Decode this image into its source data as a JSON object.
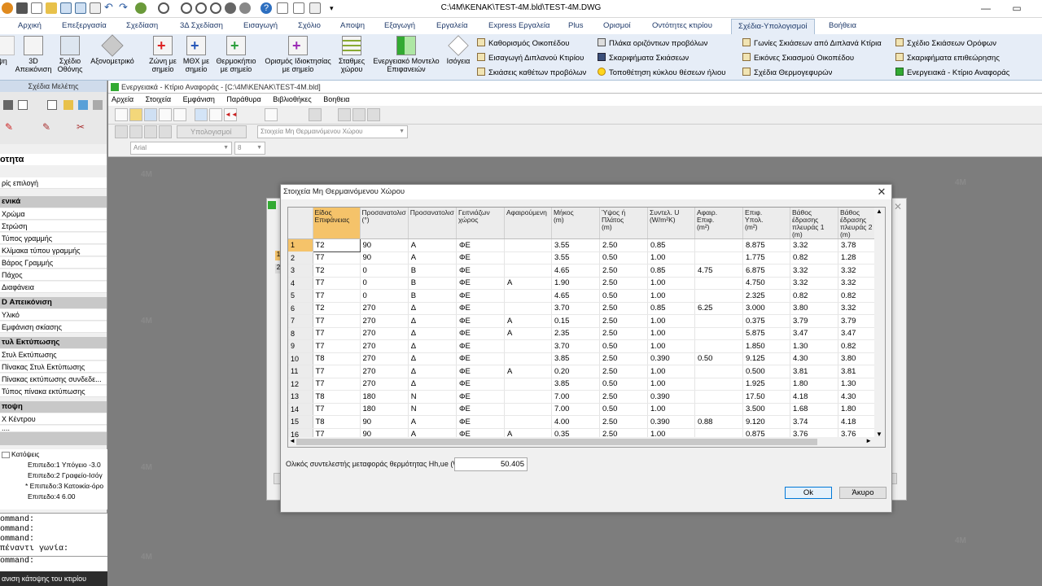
{
  "window": {
    "title": "C:\\4M\\KENAK\\TEST-4M.bld\\TEST-4M.DWG",
    "controls": [
      "—",
      "▭"
    ]
  },
  "ribbon_tabs": [
    "Αρχική",
    "Επεξεργασία",
    "Σχεδίαση",
    "3Δ Σχεδίαση",
    "Εισαγωγή",
    "Σχόλιο",
    "Αποψη",
    "Εξαγωγή",
    "Εργαλεία",
    "Express Εργαλεία",
    "Plus",
    "Ορισμοί",
    "Οντότητες κτιρίου",
    "Σχέδια-Υπολογισμοί",
    "Βοήθεια"
  ],
  "ribbon_active_tab": "Σχέδια-Υπολογισμοί",
  "ribbon_buttons": [
    {
      "label": "ψη",
      "icon": "view-icon"
    },
    {
      "label": "3D\nΑπεικόνιση",
      "icon": "3d-icon"
    },
    {
      "label": "Σχέδιο\nΟθόνης",
      "icon": "monitor-icon"
    },
    {
      "label": "Αξονομετρικό",
      "icon": "axonometric-icon"
    },
    {
      "label": "Ζώνη με\nσημείο",
      "icon": "zone-plus-icon"
    },
    {
      "label": "ΜΘΧ με\nσημείο",
      "icon": "mthx-plus-icon"
    },
    {
      "label": "Θερμοκήπιο\nμε σημείο",
      "icon": "greenhouse-plus-icon"
    },
    {
      "label": "Ορισμός Ιδιοκτησίας\nμε σημείο",
      "icon": "property-plus-icon"
    },
    {
      "label": "Σταθμες\nχώρου",
      "icon": "levels-icon"
    },
    {
      "label": "Ενεργειακό Μοντελο\nΕπιφανειών",
      "icon": "energy-model-icon"
    },
    {
      "label": "Ισόγεια",
      "icon": "ground-floor-icon"
    }
  ],
  "ribbon_small_col1": [
    "Καθορισμός Οικοπέδου",
    "Εισαγωγή Διπλανού Κτιρίου",
    "Σκιάσεις καθέτων προβόλων"
  ],
  "ribbon_small_col2": [
    "Πλάκα οριζόντιων προβόλων",
    "Σκαριφήματα Σκιάσεων",
    "Τοποθέτηση κύκλου θέσεων ήλιου"
  ],
  "ribbon_small_col3": [
    "Γωνίες Σκιάσεων από Διπλανά Κτίρια",
    "Εικόνες Σκιασμού Οικοπέδου",
    "Σχέδια Θερμογεφυρών"
  ],
  "ribbon_small_col4": [
    "Σχέδιο Σκιάσεων Ορόφων",
    "Σκαριφήματα επιθεώρησης",
    "Ενεργειακά - Κτίριο Αναφοράς"
  ],
  "ribbon_group_label": "Σχέδια Μελέτης",
  "left_panel": {
    "header": "οτητα",
    "first_item": "ρίς επιλογή",
    "sections": [
      {
        "title": "ενικά",
        "items": [
          "Χρώμα",
          "Στρώση",
          "Τύπος γραμμής",
          "Κλίμακα τύπου γραμμής",
          "Βάρος Γραμμής",
          "Πάχος",
          "Διαφάνεια"
        ]
      },
      {
        "title": "D Απεικόνιση",
        "items": [
          "Υλικό",
          "Εμφάνιση σκίασης"
        ]
      },
      {
        "title": "τυλ Εκτύπωσης",
        "items": [
          "Στυλ Εκτύπωσης",
          "Πίνακας Στυλ Εκτύπωσης",
          "Πίνακας εκτύπωσης συνδεδε...",
          "Τύπος πίνακα εκτύπωσης"
        ]
      },
      {
        "title": "ποψη",
        "items": [
          "X Κέντρου",
          "...."
        ]
      }
    ],
    "tree_root": "Κατόψεις",
    "tree_items": [
      "Επιπεδο:1 Υπόγειο -3.0",
      "Επιπεδο:2 Γραφείο-Ισόγ",
      "* Επιπεδο:3 Κατοικία-όρο",
      "Επιπεδο:4  6.00"
    ],
    "command_lines": [
      "ommand:",
      "ommand:",
      "ommand:",
      "πέναντι γωνία:",
      "ommand:"
    ],
    "status": "ανιση κάτοψης του κτιρίου"
  },
  "inner_app": {
    "title": "Ενεργειακά - Κτίριο Αναφοράς - [C:\\4M\\KENAK\\TEST-4M.bld]",
    "menu": [
      "Αρχεία",
      "Στοιχεία",
      "Εμφάνιση",
      "Παράθυρα",
      "Βιβλιοθήκες",
      "Βοηθεια"
    ],
    "compute_button": "Υπολογισμοί",
    "section_combo": "Στοιχεία Μη Θερμαινόμενου Χώρου",
    "font_combo": "Arial",
    "size_combo": "8",
    "watermark": "4M"
  },
  "bg_dialog": {
    "row_markers": [
      "1",
      "2"
    ]
  },
  "dialog": {
    "title": "Στοιχεία Μη Θερμαινόμενου Χώρου",
    "columns": [
      "Είδος\nΕπιφάνειας",
      "Προσανατολισ\n(°)",
      "Προσανατολισ",
      "Γειτνιάζων\nχώρος",
      "Αφαιρούμενη",
      "Μήκος\n(m)",
      "Ύψος ή\nΠλάτος\n(m)",
      "Συντελ. U\n(W/m²K)",
      "Αφαιρ.\nΕπιφ.\n(m²)",
      "Επιφ.\nΥπολ.\n(m²)",
      "Βάθος\nέδρασης\nπλευράς 1\n(m)",
      "Βάθος\nέδρασης\nπλευράς 2\n(m)"
    ],
    "rows": [
      [
        "1",
        "T2",
        "90",
        "A",
        "ΦΕ",
        "",
        "3.55",
        "2.50",
        "0.85",
        "",
        "8.875",
        "3.32",
        "3.78"
      ],
      [
        "2",
        "T7",
        "90",
        "A",
        "ΦΕ",
        "",
        "3.55",
        "0.50",
        "1.00",
        "",
        "1.775",
        "0.82",
        "1.28"
      ],
      [
        "3",
        "T2",
        "0",
        "B",
        "ΦΕ",
        "",
        "4.65",
        "2.50",
        "0.85",
        "4.75",
        "6.875",
        "3.32",
        "3.32"
      ],
      [
        "4",
        "T7",
        "0",
        "B",
        "ΦΕ",
        "A",
        "1.90",
        "2.50",
        "1.00",
        "",
        "4.750",
        "3.32",
        "3.32"
      ],
      [
        "5",
        "T7",
        "0",
        "B",
        "ΦΕ",
        "",
        "4.65",
        "0.50",
        "1.00",
        "",
        "2.325",
        "0.82",
        "0.82"
      ],
      [
        "6",
        "T2",
        "270",
        "Δ",
        "ΦΕ",
        "",
        "3.70",
        "2.50",
        "0.85",
        "6.25",
        "3.000",
        "3.80",
        "3.32"
      ],
      [
        "7",
        "T7",
        "270",
        "Δ",
        "ΦΕ",
        "A",
        "0.15",
        "2.50",
        "1.00",
        "",
        "0.375",
        "3.79",
        "3.79"
      ],
      [
        "8",
        "T7",
        "270",
        "Δ",
        "ΦΕ",
        "A",
        "2.35",
        "2.50",
        "1.00",
        "",
        "5.875",
        "3.47",
        "3.47"
      ],
      [
        "9",
        "T7",
        "270",
        "Δ",
        "ΦΕ",
        "",
        "3.70",
        "0.50",
        "1.00",
        "",
        "1.850",
        "1.30",
        "0.82"
      ],
      [
        "10",
        "T8",
        "270",
        "Δ",
        "ΦΕ",
        "",
        "3.85",
        "2.50",
        "0.390",
        "0.50",
        "9.125",
        "4.30",
        "3.80"
      ],
      [
        "11",
        "T7",
        "270",
        "Δ",
        "ΦΕ",
        "A",
        "0.20",
        "2.50",
        "1.00",
        "",
        "0.500",
        "3.81",
        "3.81"
      ],
      [
        "12",
        "T7",
        "270",
        "Δ",
        "ΦΕ",
        "",
        "3.85",
        "0.50",
        "1.00",
        "",
        "1.925",
        "1.80",
        "1.30"
      ],
      [
        "13",
        "T8",
        "180",
        "N",
        "ΦΕ",
        "",
        "7.00",
        "2.50",
        "0.390",
        "",
        "17.50",
        "4.18",
        "4.30"
      ],
      [
        "14",
        "T7",
        "180",
        "N",
        "ΦΕ",
        "",
        "7.00",
        "0.50",
        "1.00",
        "",
        "3.500",
        "1.68",
        "1.80"
      ],
      [
        "15",
        "T8",
        "90",
        "A",
        "ΦΕ",
        "",
        "4.00",
        "2.50",
        "0.390",
        "0.88",
        "9.120",
        "3.74",
        "4.18"
      ],
      [
        "16",
        "T7",
        "90",
        "A",
        "ΦΕ",
        "A",
        "0.35",
        "2.50",
        "1.00",
        "",
        "0.875",
        "3.76",
        "3.76"
      ]
    ],
    "coefficient_label": "Ολικός συντελεστής μεταφοράς θερμότητας Hh,ue (W/K)",
    "coefficient_value": "50.405",
    "ok_label": "Ok",
    "cancel_label": "Άκυρο"
  },
  "colors": {
    "ribbon_bg": "#e6edf7",
    "selection_orange": "#f5c36a",
    "canvas_gray": "#7d7d7d"
  }
}
